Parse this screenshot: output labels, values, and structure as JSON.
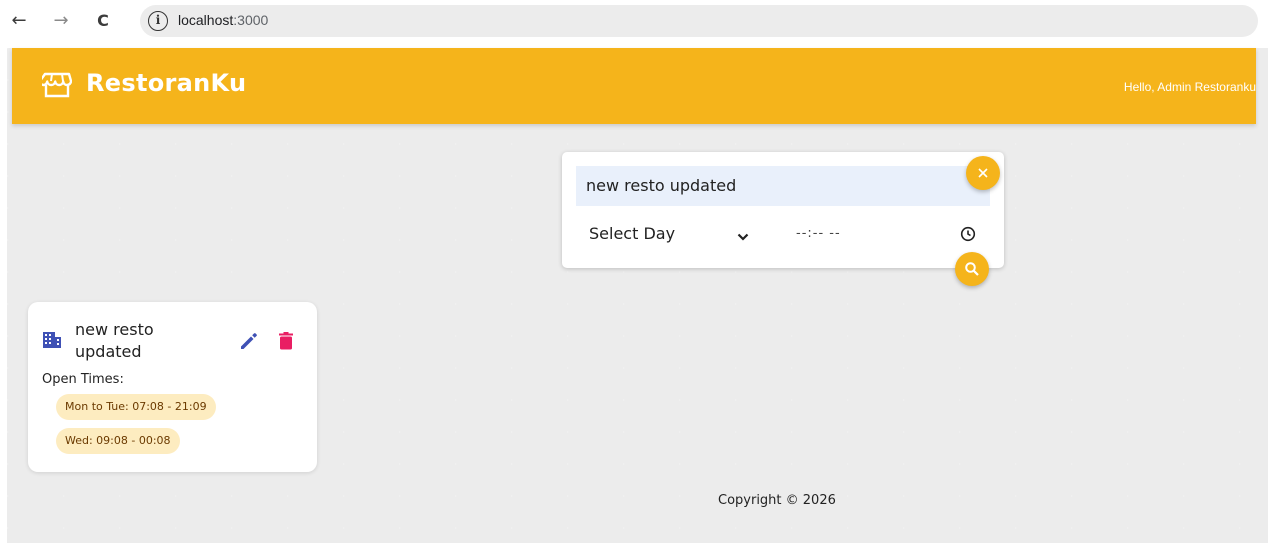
{
  "browser": {
    "back": "←",
    "forward": "→",
    "reload": "C",
    "info": "i",
    "url_host": "localhost",
    "url_port": ":3000"
  },
  "appbar": {
    "brand": "RestoranKu",
    "greeting": "Hello, Admin Restoranku",
    "color": "#f5b41b"
  },
  "search": {
    "name_value": "new resto updated",
    "day_select": "Select Day",
    "time_placeholder": "--:-- --"
  },
  "restaurant": {
    "name": "new resto updated",
    "open_times_label": "Open Times:",
    "times": [
      "Mon to Tue: 07:08 - 21:09",
      "Wed: 09:08 - 00:08"
    ]
  },
  "footer": {
    "copyright": "Copyright © 2026"
  },
  "icons": {
    "edit_color": "#3f51b5",
    "delete_color": "#e91e63",
    "building_color": "#3f51b5"
  }
}
